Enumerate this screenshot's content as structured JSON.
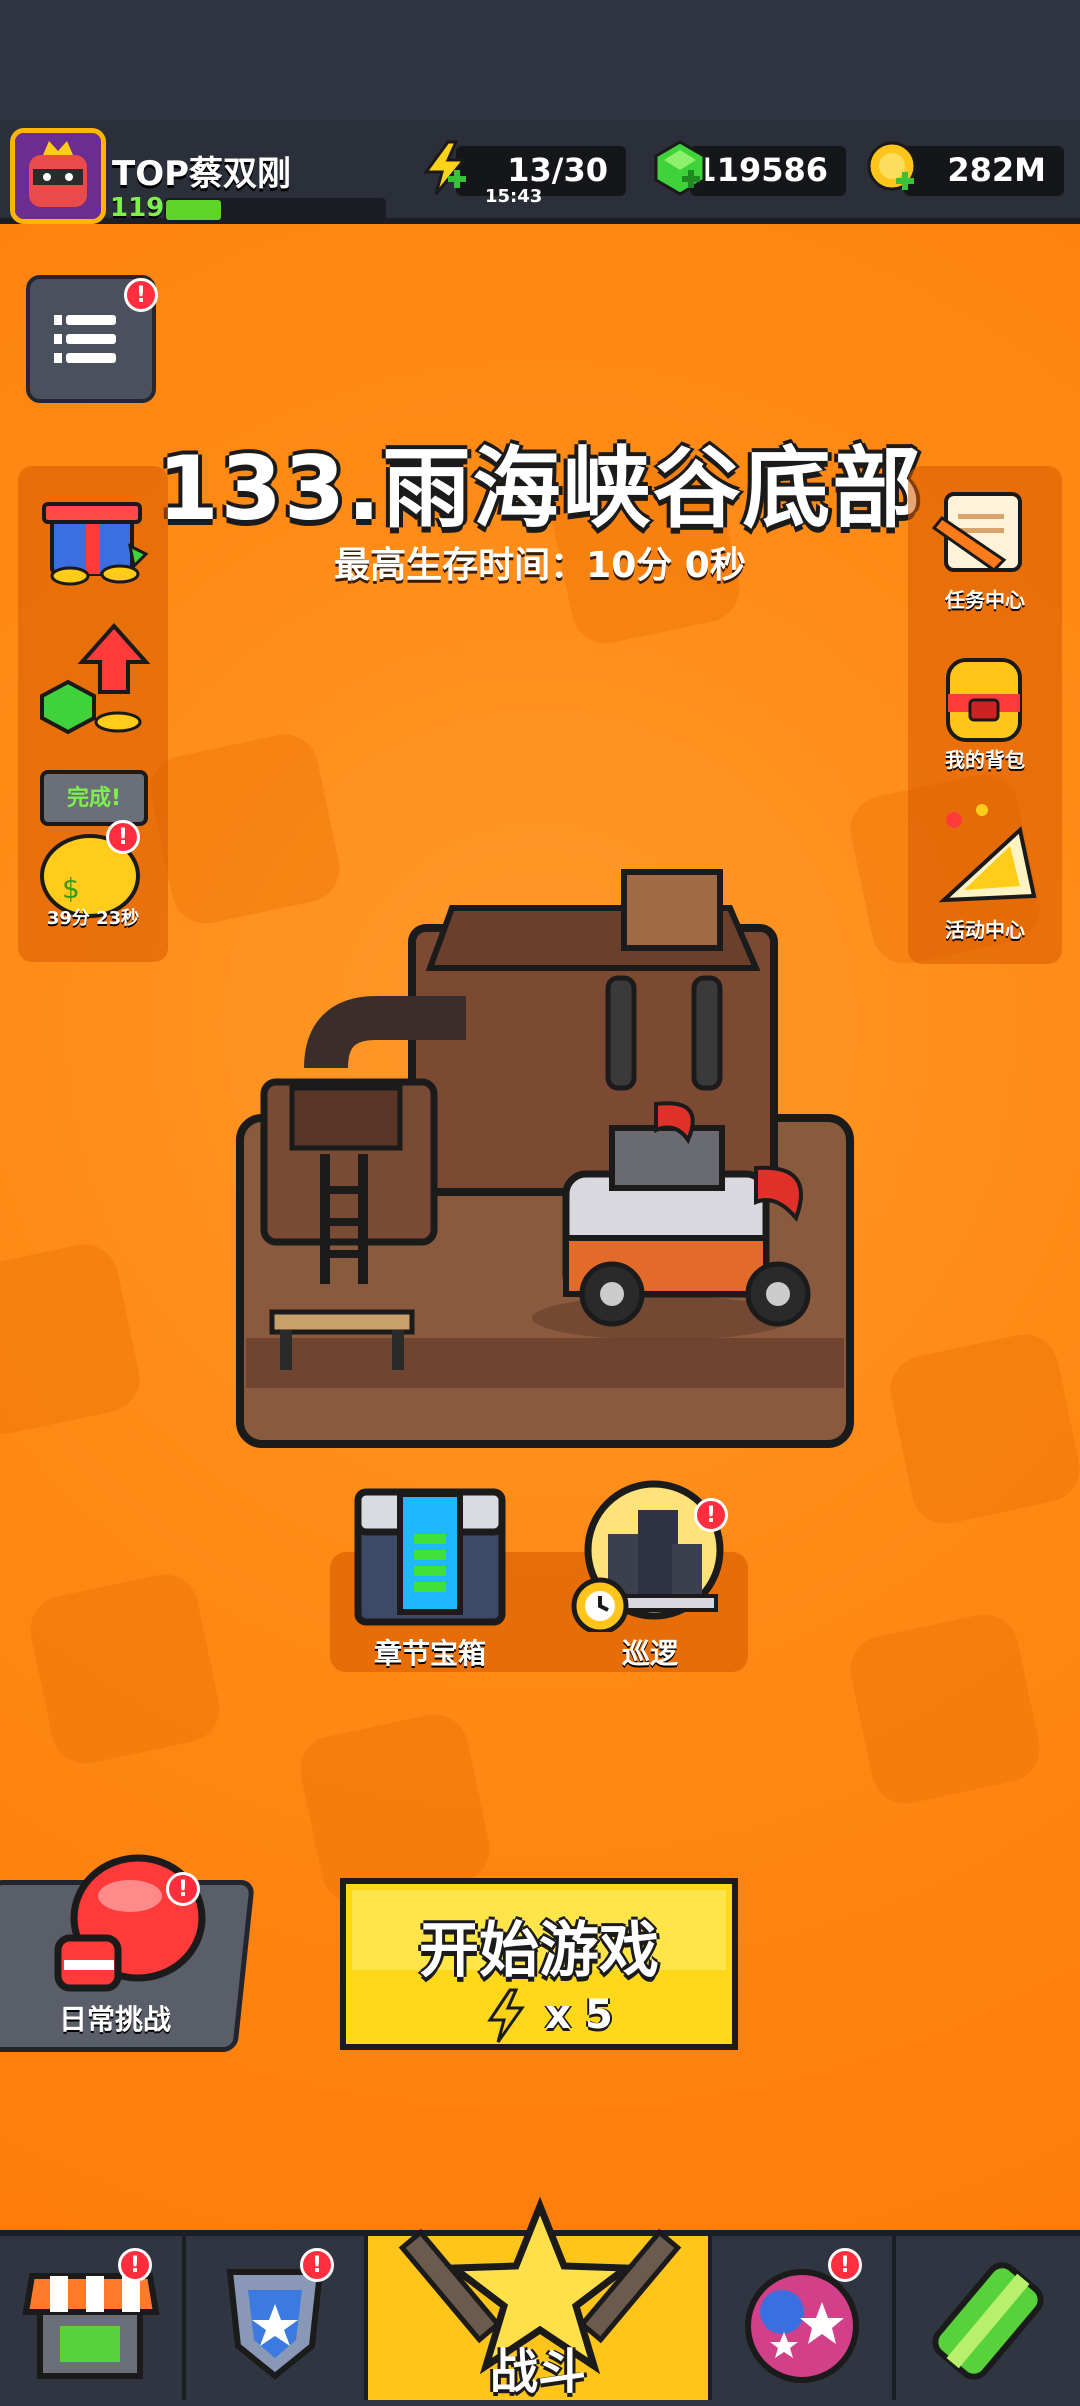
{
  "player": {
    "name": "TOP蔡双刚",
    "level": "119",
    "xp_fraction": 0.25
  },
  "resources": {
    "energy": {
      "value": "13/30",
      "timer": "15:43",
      "icon": "lightning-icon"
    },
    "gems": {
      "value": "119586",
      "icon": "green-gem-icon"
    },
    "gold": {
      "value": "282M",
      "icon": "gold-coin-icon"
    }
  },
  "stage": {
    "title": "133.雨海峡谷底部",
    "best_time": "最高生存时间：10分 0秒"
  },
  "left_panel": {
    "menu_badge": "!",
    "items": [
      {
        "icon": "gift-box-icon"
      },
      {
        "icon": "gem-upgrade-arrow-icon"
      },
      {
        "icon": "money-bag-icon",
        "bubble": "完成!",
        "badge": "!",
        "timer": "39分 23秒"
      }
    ]
  },
  "right_panel": {
    "items": [
      {
        "label": "任务中心",
        "icon": "scroll-pencil-icon"
      },
      {
        "label": "我的背包",
        "icon": "backpack-icon"
      },
      {
        "label": "活动中心",
        "icon": "party-horn-icon"
      }
    ]
  },
  "center": {
    "chest_label": "章节宝箱",
    "patrol_label": "巡逻",
    "patrol_badge": "!"
  },
  "actions": {
    "daily_label": "日常挑战",
    "daily_badge": "!",
    "start_label": "开始游戏",
    "start_cost": "x 5"
  },
  "nav": {
    "items": [
      {
        "name": "shop",
        "icon": "shop-stall-icon",
        "badge": "!"
      },
      {
        "name": "equipment",
        "icon": "shield-badge-icon",
        "badge": "!"
      },
      {
        "name": "battle",
        "label": "战斗",
        "icon": "star-swords-icon"
      },
      {
        "name": "talents",
        "icon": "star-orb-icon",
        "badge": "!"
      },
      {
        "name": "evolution",
        "icon": "dna-capsule-icon"
      }
    ]
  },
  "colors": {
    "background": "#ff8a16",
    "start_button": "#ffd81a",
    "badge": "#ff2e3f",
    "topbar": "#2b2f3a"
  }
}
